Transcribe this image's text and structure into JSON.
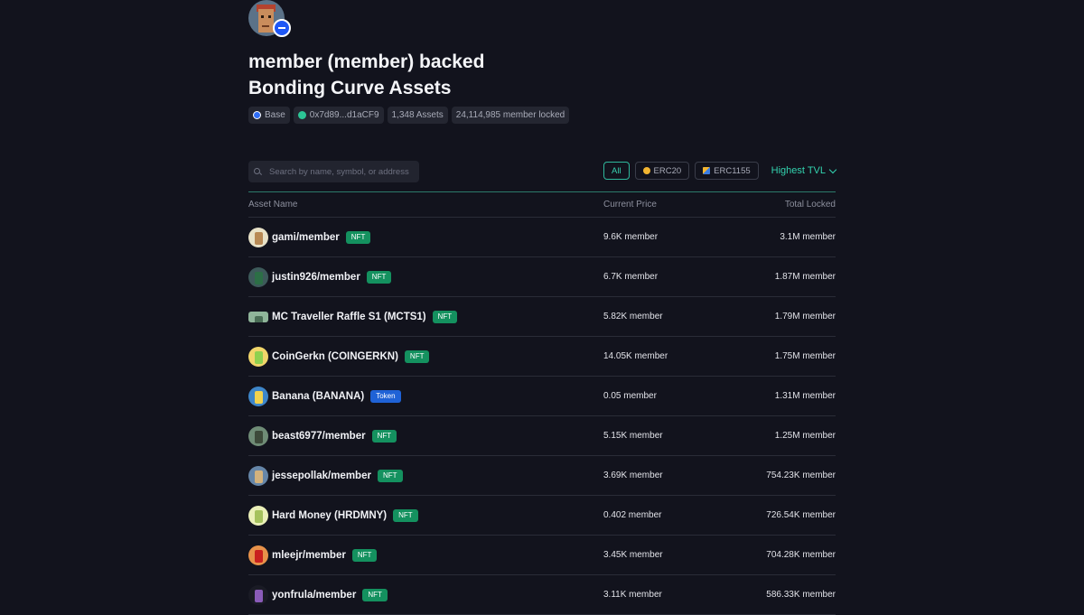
{
  "header": {
    "title_line1": "member (member) backed",
    "title_line2": "Bonding Curve Assets",
    "chips": [
      {
        "label": "Base",
        "icon_color": "#2f6df5"
      },
      {
        "label": "0x7d89...d1aCF9",
        "icon_color": "#2cc495"
      },
      {
        "label": "1,348 Assets"
      },
      {
        "label": "24,114,985 member locked"
      }
    ]
  },
  "search": {
    "placeholder": "Search by name, symbol, or address",
    "value": ""
  },
  "filters": {
    "all": "All",
    "erc20": "ERC20",
    "erc1155": "ERC1155",
    "sort": "Highest TVL"
  },
  "table": {
    "columns": [
      "Asset Name",
      "Current Price",
      "Total Locked"
    ],
    "rows": [
      {
        "name": "gami/member",
        "badge": "NFT",
        "price": "9.6K member",
        "locked": "3.1M member",
        "icon_bg": "#e8e2c8",
        "icon_fg": "#b88a55"
      },
      {
        "name": "justin926/member",
        "badge": "NFT",
        "price": "6.7K member",
        "locked": "1.87M member",
        "icon_bg": "#3d5a5a",
        "icon_fg": "#2c6f46"
      },
      {
        "name": "MC Traveller Raffle S1 (MCTS1)",
        "badge": "NFT",
        "price": "5.82K member",
        "locked": "1.79M member",
        "icon_bg": "#8fb59a",
        "icon_fg": "#4a6e56"
      },
      {
        "name": "CoinGerkn (COINGERKN)",
        "badge": "NFT",
        "price": "14.05K member",
        "locked": "1.75M member",
        "icon_bg": "#f1d66a",
        "icon_fg": "#8fd14f"
      },
      {
        "name": "Banana (BANANA)",
        "badge": "Token",
        "price": "0.05 member",
        "locked": "1.31M member",
        "icon_bg": "#3e86c9",
        "icon_fg": "#f2d24e"
      },
      {
        "name": "beast6977/member",
        "badge": "NFT",
        "price": "5.15K member",
        "locked": "1.25M member",
        "icon_bg": "#6f8c76",
        "icon_fg": "#3d4a3a"
      },
      {
        "name": "jessepollak/member",
        "badge": "NFT",
        "price": "3.69K member",
        "locked": "754.23K member",
        "icon_bg": "#6686a8",
        "icon_fg": "#d3b27d"
      },
      {
        "name": "Hard Money (HRDMNY)",
        "badge": "NFT",
        "price": "0.402 member",
        "locked": "726.54K member",
        "icon_bg": "#eaf0b8",
        "icon_fg": "#a5c25d"
      },
      {
        "name": "mleejr/member",
        "badge": "NFT",
        "price": "3.45K member",
        "locked": "704.28K member",
        "icon_bg": "#e8924a",
        "icon_fg": "#c9211f"
      },
      {
        "name": "yonfrula/member",
        "badge": "NFT",
        "price": "3.11K member",
        "locked": "586.33K member",
        "icon_bg": "#1a1b25",
        "icon_fg": "#8a5bb8"
      }
    ]
  },
  "colors": {
    "nft_badge": "#14915f",
    "token_badge": "#1f62d6",
    "accent": "#33d3af"
  }
}
